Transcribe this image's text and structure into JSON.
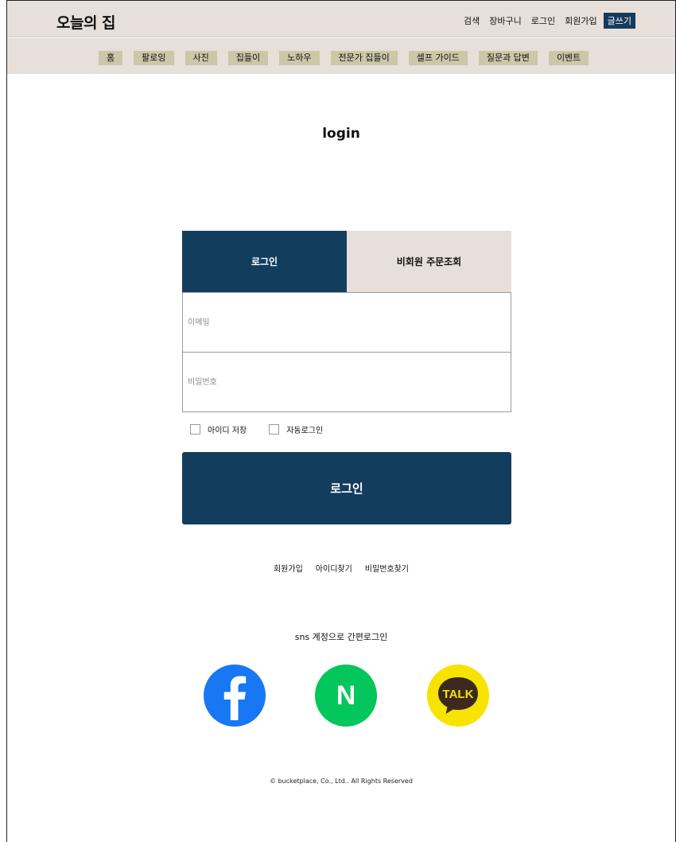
{
  "header": {
    "brand": "오늘의 집",
    "utility_links": [
      "검색",
      "장바구니",
      "로그인",
      "회원가입"
    ],
    "write_button": "글쓰기"
  },
  "nav": {
    "items": [
      "홈",
      "팔로잉",
      "사진",
      "집들이",
      "노하우",
      "전문가 집들이",
      "셀프 가이드",
      "질문과 답변",
      "이벤트"
    ]
  },
  "page": {
    "title": "login"
  },
  "tabs": {
    "login": "로그인",
    "guest_order": "비회원 주문조회"
  },
  "form": {
    "email_placeholder": "이메일",
    "password_placeholder": "비밀번호",
    "save_id_label": "아이디 저장",
    "auto_login_label": "자동로그인",
    "submit_label": "로그인"
  },
  "links": {
    "signup": "회원가입",
    "find_id": "아이디찾기",
    "find_password": "비밀번호찾기"
  },
  "sns": {
    "title": "sns 계정으로 간편로그인",
    "icons": [
      "facebook-icon",
      "naver-icon",
      "kakaotalk-icon"
    ],
    "kakao_text": "TALK",
    "naver_text": "N"
  },
  "footer": {
    "copyright": "© bucketplace, Co., Ltd.. All Rights Reserved"
  },
  "colors": {
    "primary": "#133d5d",
    "header_bg": "#e7dfd9",
    "nav_item_bg": "#cbc7a7"
  }
}
